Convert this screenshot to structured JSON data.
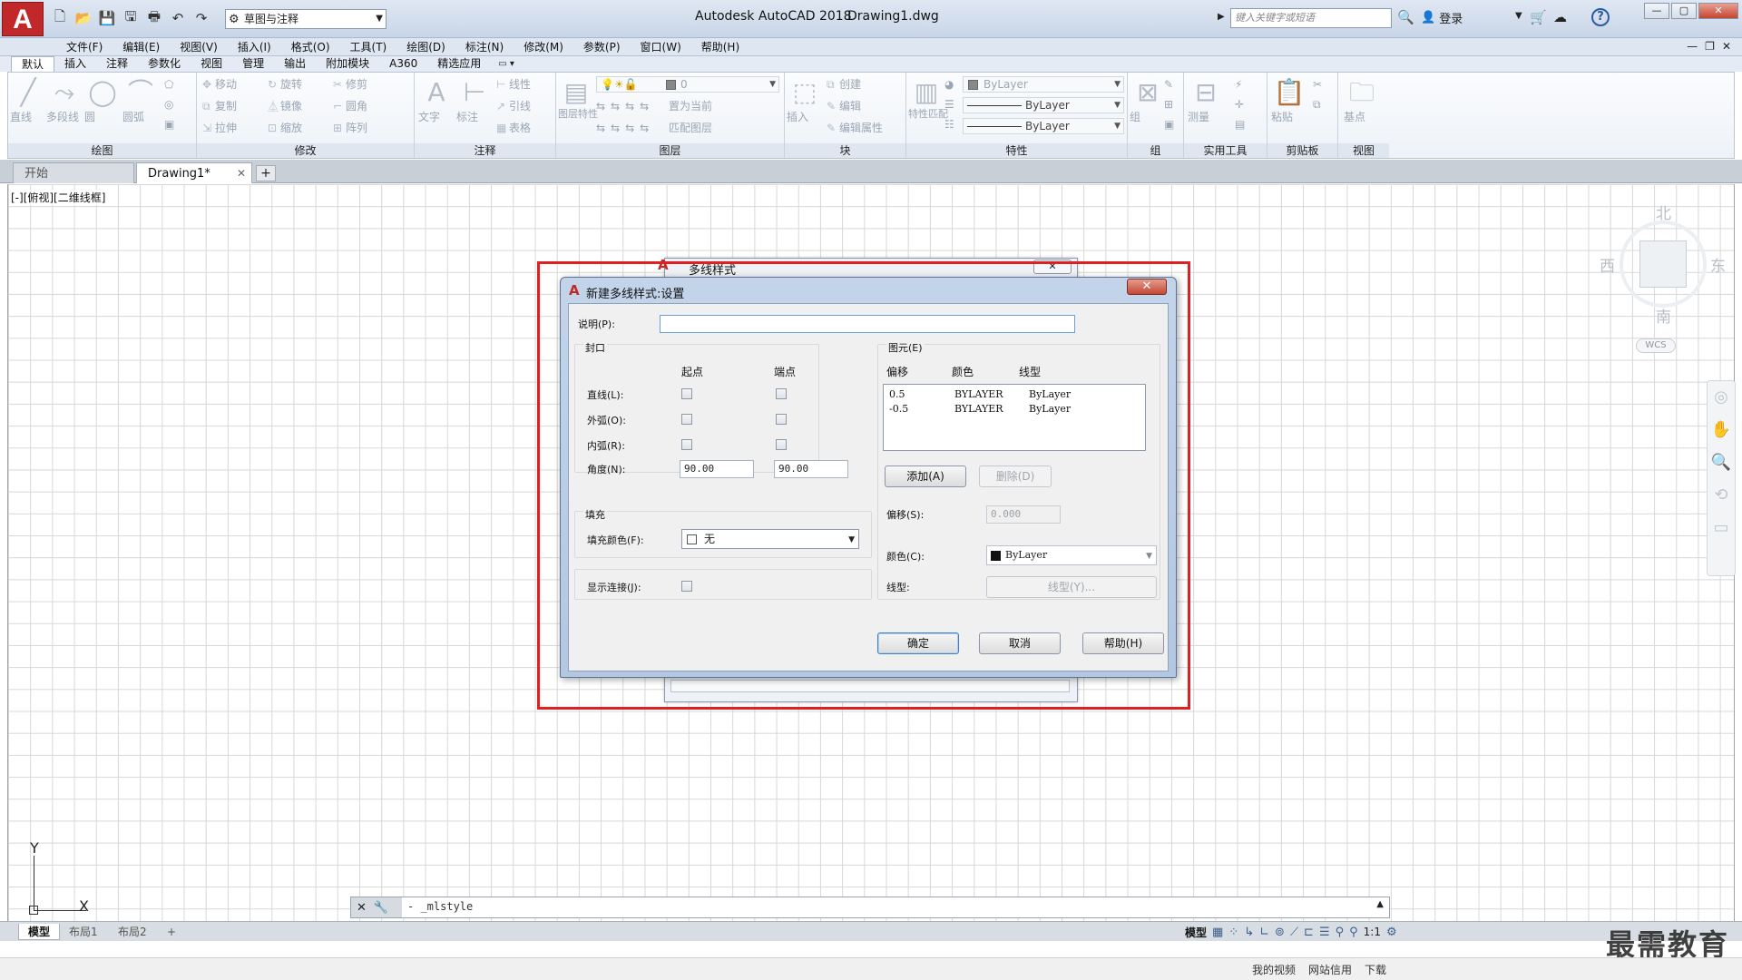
{
  "titlebar": {
    "logo": "A",
    "workspace": "草图与注释",
    "app_title": "Autodesk AutoCAD 2018",
    "doc_title": "Drawing1.dwg",
    "search_placeholder": "键入关键字或短语",
    "login": "登录"
  },
  "menu": [
    "文件(F)",
    "编辑(E)",
    "视图(V)",
    "插入(I)",
    "格式(O)",
    "工具(T)",
    "绘图(D)",
    "标注(N)",
    "修改(M)",
    "参数(P)",
    "窗口(W)",
    "帮助(H)"
  ],
  "ribbon_tabs": [
    "默认",
    "插入",
    "注释",
    "参数化",
    "视图",
    "管理",
    "输出",
    "附加模块",
    "A360",
    "精选应用"
  ],
  "ribbon": {
    "draw": {
      "title": "绘图",
      "line": "直线",
      "polyline": "多段线",
      "circle": "圆",
      "arc": "圆弧"
    },
    "modify": {
      "title": "修改",
      "move": "移动",
      "rotate": "旋转",
      "trim": "修剪",
      "copy": "复制",
      "mirror": "镜像",
      "fillet": "圆角",
      "stretch": "拉伸",
      "scale": "缩放",
      "array": "阵列"
    },
    "annotation": {
      "title": "注释",
      "text": "文字",
      "dimension": "标注",
      "linear": "线性",
      "leader": "引线",
      "table": "表格"
    },
    "layers": {
      "title": "图层",
      "properties": "图层特性",
      "current_layer": "0",
      "set_current": "置为当前",
      "match_layer": "匹配图层"
    },
    "block": {
      "title": "块",
      "insert": "插入",
      "create": "创建",
      "edit": "编辑",
      "edit_attr": "编辑属性"
    },
    "properties": {
      "title": "特性",
      "match": "特性匹配",
      "color": "ByLayer",
      "linetype": "ByLayer",
      "lineweight": "ByLayer"
    },
    "groups": {
      "title": "组",
      "group": "组"
    },
    "utilities": {
      "title": "实用工具",
      "measure": "测量"
    },
    "clipboard": {
      "title": "剪贴板",
      "paste": "粘贴"
    },
    "view": {
      "title": "视图",
      "base": "基点"
    }
  },
  "filetabs": {
    "start": "开始",
    "drawing": "Drawing1*",
    "new": "+"
  },
  "viewport": {
    "label": "[-][俯视][二维线框]",
    "north": "北",
    "south": "南",
    "east": "东",
    "west": "西",
    "wcs": "WCS",
    "ucs_x": "X",
    "ucs_y": "Y"
  },
  "command": {
    "prompt": "- _mlstyle"
  },
  "layout_tabs": [
    "模型",
    "布局1",
    "布局2",
    "+"
  ],
  "status": {
    "model": "模型",
    "scale": "1:1"
  },
  "watermark": "最需教育",
  "taskbar": [
    "我的视频",
    "网站信用",
    "下载"
  ],
  "behind_dialog": {
    "title": "多线样式"
  },
  "dialog": {
    "title": "新建多线样式:设置",
    "description_label": "说明(P):",
    "description_value": "",
    "caps": {
      "title": "封口",
      "start": "起点",
      "end": "端点",
      "line": "直线(L):",
      "outer_arc": "外弧(O):",
      "inner_arc": "内弧(R):",
      "angle": "角度(N):",
      "angle_start": "90.00",
      "angle_end": "90.00"
    },
    "fill": {
      "title": "填充",
      "color_label": "填充颜色(F):",
      "color_value": "无"
    },
    "show_joints": "显示连接(J):",
    "elements": {
      "title": "图元(E)",
      "col_offset": "偏移",
      "col_color": "颜色",
      "col_linetype": "线型",
      "rows": [
        {
          "offset": "0.5",
          "color": "BYLAYER",
          "linetype": "ByLayer"
        },
        {
          "offset": "-0.5",
          "color": "BYLAYER",
          "linetype": "ByLayer"
        }
      ],
      "add": "添加(A)",
      "delete": "删除(D)",
      "offset_label": "偏移(S):",
      "offset_value": "0.000",
      "color_label": "颜色(C):",
      "color_value": "ByLayer",
      "linetype_label": "线型:",
      "linetype_button": "线型(Y)..."
    },
    "ok": "确定",
    "cancel": "取消",
    "help": "帮助(H)"
  }
}
